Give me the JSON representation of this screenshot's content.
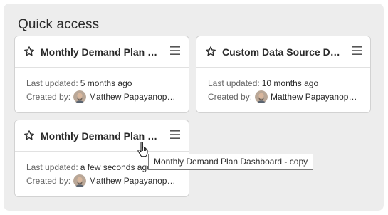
{
  "section": {
    "title": "Quick access"
  },
  "cards": [
    {
      "title": "Monthly Demand Plan Dashboard - copy",
      "last_updated_label": "Last updated:",
      "last_updated": "5 months ago",
      "created_by_label": "Created by:",
      "creator": "Matthew Papayanopulos"
    },
    {
      "title": "Custom Data Source Dashboard",
      "last_updated_label": "Last updated:",
      "last_updated": "10 months ago",
      "created_by_label": "Created by:",
      "creator": "Matthew Papayanopulos"
    },
    {
      "title": "Monthly Demand Plan Dashboard - copy",
      "last_updated_label": "Last updated:",
      "last_updated": "a few seconds ago",
      "created_by_label": "Created by:",
      "creator": "Matthew Papayanopulos"
    }
  ],
  "tooltip": {
    "text": "Monthly Demand Plan Dashboard - copy"
  },
  "icons": {
    "favorite": "star-outline-icon",
    "menu": "hamburger-menu-icon",
    "cursor": "hand-pointer-cursor"
  },
  "colors": {
    "panel_bg": "#ededed",
    "card_border": "#d2d2d2",
    "text": "#2b2b2b",
    "muted": "#666666"
  }
}
